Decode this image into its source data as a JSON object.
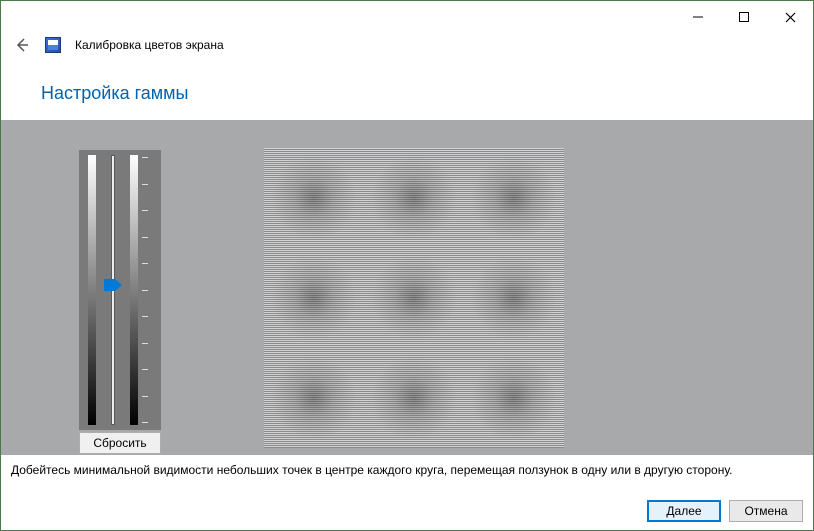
{
  "window": {
    "title": "Калибровка цветов экрана"
  },
  "page": {
    "heading": "Настройка гаммы",
    "instruction": "Добейтесь минимальной видимости небольших точек в центре каждого круга, перемещая ползунок в одну или в другую сторону."
  },
  "controls": {
    "reset": "Сбросить",
    "next": "Далее",
    "cancel": "Отмена"
  },
  "slider": {
    "value": 50,
    "min": 0,
    "max": 100
  }
}
